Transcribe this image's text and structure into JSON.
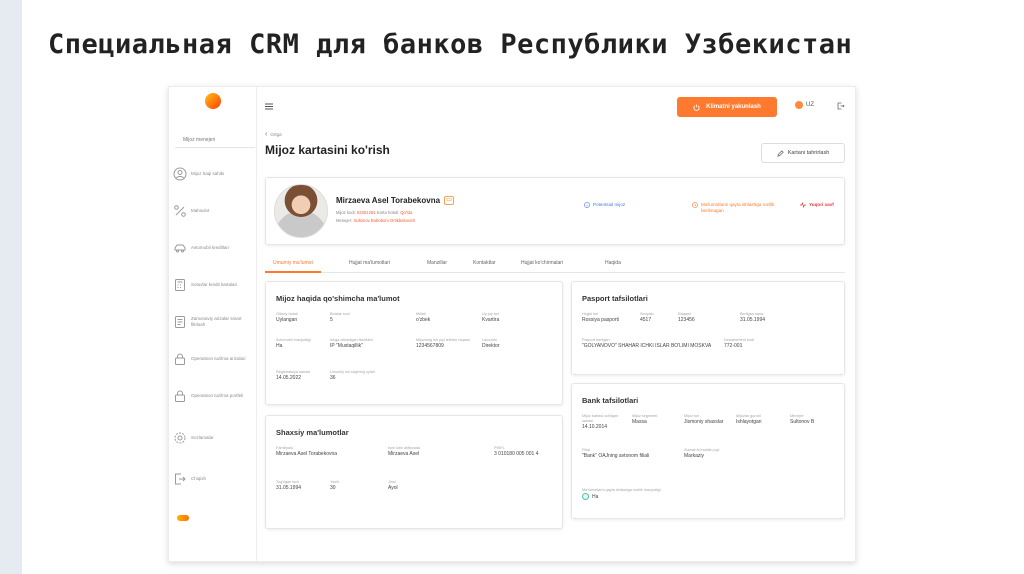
{
  "slide": {
    "title": "Специальная CRM для банков Республики Узбекистан"
  },
  "sidebar": {
    "top_label": "Mijoz menejeri",
    "items": [
      {
        "icon": "user-circle-icon",
        "label": "Mijoz haqi sahibi"
      },
      {
        "icon": "percent-icon",
        "label": "Mahsulot"
      },
      {
        "icon": "car-icon",
        "label": "Avtomobil kreditlari"
      },
      {
        "icon": "calculator-icon",
        "label": "Sotuvlar kredit kartalari"
      },
      {
        "icon": "document-icon",
        "label": "Zamonaviy arizalar smart filtrlash"
      },
      {
        "icon": "lock-icon",
        "label": "Operatsion tuzilma arizalari"
      },
      {
        "icon": "lock-icon",
        "label": "Operatsion tuzilma portfeli"
      },
      {
        "icon": "gear-icon",
        "label": "Sozlamalar"
      },
      {
        "icon": "logout-icon",
        "label": "Chiqish"
      }
    ]
  },
  "header": {
    "end_button": "Klimatni yakunlash",
    "lang": "UZ"
  },
  "page": {
    "back_label": "Ortga",
    "title": "Mijoz kartasini ko'rish",
    "edit_button": "Kartani tahrirlash"
  },
  "profile": {
    "name": "Mirzaeva Asel Torabekovna",
    "line1_label": "Mijoz kodi:",
    "line1_code": "53351261",
    "line1_mid": "Karta holati:",
    "line1_status": "Qo'lda",
    "line2_label": "Menejer:",
    "line2_value": "Sultonov Bobobom Ortikbekovich",
    "status1": "Potentsial mijoz",
    "status2": "Ma'lumotlarni qayta ishlashga rozilik berilmagan",
    "status3": "Yuqori xavf"
  },
  "tabs": [
    "Umumiy ma'lumot",
    "Hujjat ma'lumotlari",
    "Manzillar",
    "Kontaktlar",
    "Hujjat ko'chirmalari",
    "Haqida"
  ],
  "extra_info": {
    "title": "Mijoz haqida qo'shimcha ma'lumot",
    "fields": [
      {
        "label": "Oilaviy holati",
        "value": "Uylangan"
      },
      {
        "label": "Bolalar soni",
        "value": "5"
      },
      {
        "label": "Millati",
        "value": "o'zbek"
      },
      {
        "label": "Uy-joy turi",
        "value": "Kvartira"
      },
      {
        "label": "Avtomobil mavjudligi",
        "value": "Ha"
      },
      {
        "label": "Ishga olinadigan tashkilot",
        "value": "IP \"Mustaqillik\""
      },
      {
        "label": "Mijozning ish joyi telefon raqami",
        "value": "1234567809"
      },
      {
        "label": "Lavozimi",
        "value": "Direktor"
      },
      {
        "label": "Registratsiya sanasi",
        "value": "14.05.2022"
      },
      {
        "label": "Umumiy ish stajining oylari",
        "value": "36"
      }
    ]
  },
  "personal": {
    "title": "Shaxsiy ma'lumotlar",
    "fields": [
      {
        "label": "Familiyasi",
        "value": "Mirzaeva Asel Torabekovna"
      },
      {
        "label": "Ismi lotin alifbosida",
        "value": "Mirzaeva Asel"
      },
      {
        "label": "PINFL",
        "value": "3 010180 005 001 4"
      },
      {
        "label": "Tug'ilgan kuni",
        "value": "31.05.1994"
      },
      {
        "label": "Yoshi",
        "value": "30"
      },
      {
        "label": "Jinsi",
        "value": "Ayol"
      }
    ]
  },
  "passport": {
    "title": "Pasport tafsilotlari",
    "fields": [
      {
        "label": "Hujjat turi",
        "value": "Rossiya pasporti"
      },
      {
        "label": "Seriyasi",
        "value": "4517"
      },
      {
        "label": "Raqami",
        "value": "123456"
      },
      {
        "label": "Berilgan sana",
        "value": "31.05.1994"
      },
      {
        "label": "Pasport berilgan",
        "value": "\"GOLYANOVO\" SHAHAR ICHKI ISLAR BO'LIMI MOSKVA"
      },
      {
        "label": "Departament kodi",
        "value": "772-001"
      }
    ]
  },
  "bank": {
    "title": "Bank tafsilotlari",
    "fields": [
      {
        "label": "Mijoz kartasi ochilgan sanasi",
        "value": "14.10.2014"
      },
      {
        "label": "Mijoz segmenti",
        "value": "Massa"
      },
      {
        "label": "Mijoz turi",
        "value": "Jismoniy shaxslar"
      },
      {
        "label": "Mijozlar guruhi",
        "value": "Ishlayotgan"
      },
      {
        "label": "Menejer",
        "value": "Sultonov B"
      },
      {
        "label": "Filial",
        "value": "\"Bank\" OAJning avtonom filiali"
      },
      {
        "label": "Xizmat ko'rsatish joyi",
        "value": "Markaziy"
      }
    ],
    "consent_label": "Ma'lumotlarni qayta ishlashga rozilik mavjudligi",
    "consent_value": "Ha"
  }
}
